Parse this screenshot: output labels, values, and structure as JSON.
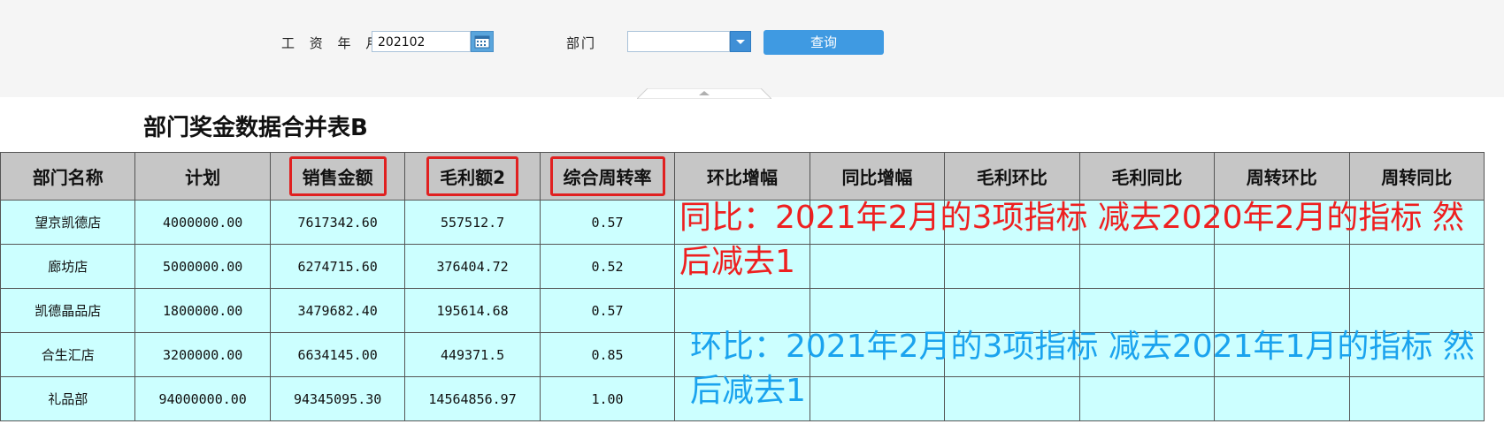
{
  "filter": {
    "month_label": "工 资 年 月",
    "month_value": "202102",
    "dept_label": "部门",
    "dept_value": "",
    "query_label": "查询"
  },
  "report": {
    "title": "部门奖金数据合并表B",
    "columns": [
      "部门名称",
      "计划",
      "销售金额",
      "毛利额2",
      "综合周转率",
      "环比增幅",
      "同比增幅",
      "毛利环比",
      "毛利同比",
      "周转环比",
      "周转同比"
    ],
    "highlighted_columns": [
      "销售金额",
      "毛利额2",
      "综合周转率"
    ],
    "rows": [
      [
        "望京凯德店",
        "4000000.00",
        "7617342.60",
        "557512.7",
        "0.57",
        "",
        "",
        "",
        "",
        "",
        ""
      ],
      [
        "廊坊店",
        "5000000.00",
        "6274715.60",
        "376404.72",
        "0.52",
        "",
        "",
        "",
        "",
        "",
        ""
      ],
      [
        "凯德晶品店",
        "1800000.00",
        "3479682.40",
        "195614.68",
        "0.57",
        "",
        "",
        "",
        "",
        "",
        ""
      ],
      [
        "合生汇店",
        "3200000.00",
        "6634145.00",
        "449371.5",
        "0.85",
        "",
        "",
        "",
        "",
        "",
        ""
      ],
      [
        "礼品部",
        "94000000.00",
        "94345095.30",
        "14564856.97",
        "1.00",
        "",
        "",
        "",
        "",
        "",
        ""
      ]
    ]
  },
  "annotations": {
    "yoy": "同比：2021年2月的3项指标 减去2020年2月的指标 然后减去1",
    "mom": "环比：2021年2月的3项指标 减去2021年1月的指标 然后减去1"
  },
  "colors": {
    "header_bg": "#c6c6c6",
    "row_bg": "#ccffff",
    "highlight_border": "#e02020",
    "note_red": "#ee2020",
    "note_blue": "#1aa3ee",
    "button": "#3f9ae2"
  },
  "icons": [
    "calendar-icon",
    "chevron-down-icon",
    "collapse-arrow-icon"
  ]
}
